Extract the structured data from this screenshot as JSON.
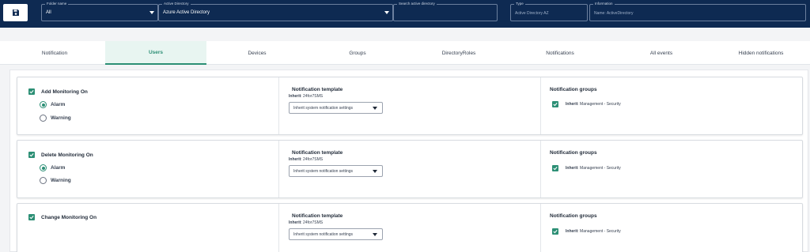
{
  "topbar": {
    "folder": {
      "label": "Folder name",
      "value": "All"
    },
    "active_directory": {
      "label": "Active Directory",
      "value": "Azure Active Directory"
    },
    "search": {
      "label": "Search active directory",
      "value": ""
    },
    "type": {
      "label": "Type",
      "value": "Active Directory AZ"
    },
    "information": {
      "label": "Information",
      "value": "Name: ActiveDirectory"
    }
  },
  "tabs": [
    {
      "label": "Notification",
      "active": false
    },
    {
      "label": "Users",
      "active": true
    },
    {
      "label": "Devices",
      "active": false
    },
    {
      "label": "Groups",
      "active": false
    },
    {
      "label": "DirectoryRoles",
      "active": false
    },
    {
      "label": "Notifications",
      "active": false
    },
    {
      "label": "All events",
      "active": false
    },
    {
      "label": "Hidden notifications",
      "active": false
    }
  ],
  "cards": [
    {
      "title": "Add Monitoring On",
      "checked": true,
      "options": [
        {
          "label": "Alarm",
          "selected": true
        },
        {
          "label": "Warning",
          "selected": false
        }
      ],
      "template_title": "Notification template",
      "inherit_label": "Inherit",
      "inherit_value": ": 24for7SMS",
      "select_value": "Inherit system notification settings",
      "groups_title": "Notification groups",
      "group_item_label": "Inherit",
      "group_item_value": ": Management - Security"
    },
    {
      "title": "Delete Monitoring On",
      "checked": true,
      "options": [
        {
          "label": "Alarm",
          "selected": true
        },
        {
          "label": "Warning",
          "selected": false
        }
      ],
      "template_title": "Notification template",
      "inherit_label": "Inherit",
      "inherit_value": ": 24for7SMS",
      "select_value": "Inherit system notification settings",
      "groups_title": "Notification groups",
      "group_item_label": "Inherit",
      "group_item_value": ": Management - Security"
    },
    {
      "title": "Change Monitoring On",
      "checked": true,
      "options": [],
      "template_title": "Notification template",
      "inherit_label": "Inherit",
      "inherit_value": ": 24for7SMS",
      "select_value": "Inherit system notification settings",
      "groups_title": "Notification groups",
      "group_item_label": "Inherit",
      "group_item_value": ": Management - Security"
    }
  ],
  "colors": {
    "navy": "#0e2a52",
    "accent": "#2c8f75"
  }
}
